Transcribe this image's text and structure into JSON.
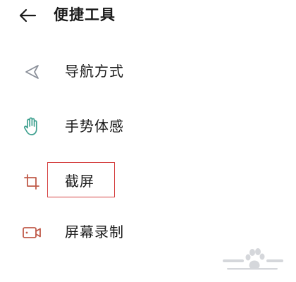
{
  "header": {
    "back_icon": "arrow-left-icon",
    "title": "便捷工具"
  },
  "menu": {
    "items": [
      {
        "label": "导航方式",
        "icon": "navigation-triangle-icon"
      },
      {
        "label": "手势体感",
        "icon": "hand-gesture-icon"
      },
      {
        "label": "截屏",
        "icon": "crop-icon"
      },
      {
        "label": "屏幕录制",
        "icon": "video-camera-icon"
      }
    ]
  },
  "watermark": {
    "icon": "baidu-paw-logo-icon"
  },
  "colors": {
    "text": "#1a1a1a",
    "icon_nav": "#8a8f99",
    "icon_gesture": "#3ea08f",
    "icon_crop": "#c05b4a",
    "icon_record": "#c05b4a",
    "highlight": "#d64545"
  }
}
